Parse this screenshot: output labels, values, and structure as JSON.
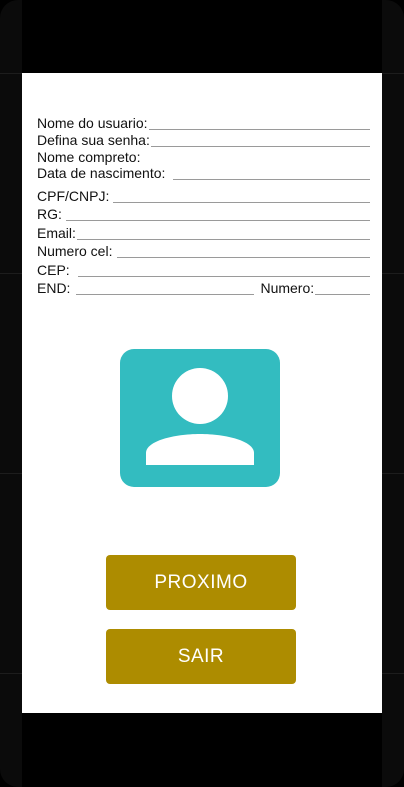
{
  "form": {
    "username_label": "Nome do usuario:",
    "password_label": "Defina sua senha:",
    "fullname_label": "Nome compreto:",
    "birthdate_label": "Data de nascimento:",
    "cpf_label": "CPF/CNPJ:",
    "rg_label": "RG:",
    "email_label": "Email:",
    "phone_label": "Numero cel:",
    "cep_label": "CEP:",
    "address_label": "END:",
    "number_label": "Numero:"
  },
  "avatar": {
    "icon": "person-icon",
    "color": "#33bcc0"
  },
  "buttons": {
    "next_label": "PROXIMO",
    "exit_label": "SAIR",
    "color": "#ad8c00"
  }
}
